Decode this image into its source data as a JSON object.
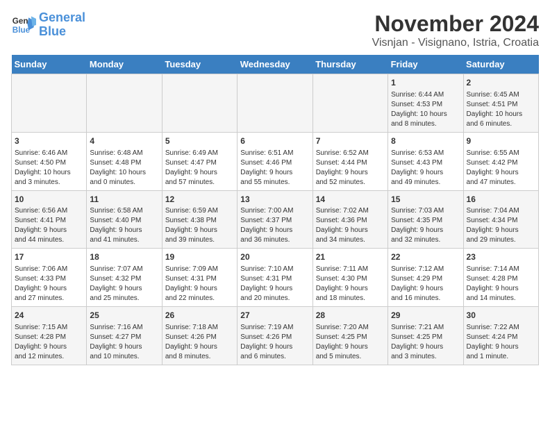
{
  "logo": {
    "line1": "General",
    "line2": "Blue"
  },
  "title": "November 2024",
  "subtitle": "Visnjan - Visignano, Istria, Croatia",
  "weekdays": [
    "Sunday",
    "Monday",
    "Tuesday",
    "Wednesday",
    "Thursday",
    "Friday",
    "Saturday"
  ],
  "weeks": [
    [
      {
        "day": "",
        "info": ""
      },
      {
        "day": "",
        "info": ""
      },
      {
        "day": "",
        "info": ""
      },
      {
        "day": "",
        "info": ""
      },
      {
        "day": "",
        "info": ""
      },
      {
        "day": "1",
        "info": "Sunrise: 6:44 AM\nSunset: 4:53 PM\nDaylight: 10 hours\nand 8 minutes."
      },
      {
        "day": "2",
        "info": "Sunrise: 6:45 AM\nSunset: 4:51 PM\nDaylight: 10 hours\nand 6 minutes."
      }
    ],
    [
      {
        "day": "3",
        "info": "Sunrise: 6:46 AM\nSunset: 4:50 PM\nDaylight: 10 hours\nand 3 minutes."
      },
      {
        "day": "4",
        "info": "Sunrise: 6:48 AM\nSunset: 4:48 PM\nDaylight: 10 hours\nand 0 minutes."
      },
      {
        "day": "5",
        "info": "Sunrise: 6:49 AM\nSunset: 4:47 PM\nDaylight: 9 hours\nand 57 minutes."
      },
      {
        "day": "6",
        "info": "Sunrise: 6:51 AM\nSunset: 4:46 PM\nDaylight: 9 hours\nand 55 minutes."
      },
      {
        "day": "7",
        "info": "Sunrise: 6:52 AM\nSunset: 4:44 PM\nDaylight: 9 hours\nand 52 minutes."
      },
      {
        "day": "8",
        "info": "Sunrise: 6:53 AM\nSunset: 4:43 PM\nDaylight: 9 hours\nand 49 minutes."
      },
      {
        "day": "9",
        "info": "Sunrise: 6:55 AM\nSunset: 4:42 PM\nDaylight: 9 hours\nand 47 minutes."
      }
    ],
    [
      {
        "day": "10",
        "info": "Sunrise: 6:56 AM\nSunset: 4:41 PM\nDaylight: 9 hours\nand 44 minutes."
      },
      {
        "day": "11",
        "info": "Sunrise: 6:58 AM\nSunset: 4:40 PM\nDaylight: 9 hours\nand 41 minutes."
      },
      {
        "day": "12",
        "info": "Sunrise: 6:59 AM\nSunset: 4:38 PM\nDaylight: 9 hours\nand 39 minutes."
      },
      {
        "day": "13",
        "info": "Sunrise: 7:00 AM\nSunset: 4:37 PM\nDaylight: 9 hours\nand 36 minutes."
      },
      {
        "day": "14",
        "info": "Sunrise: 7:02 AM\nSunset: 4:36 PM\nDaylight: 9 hours\nand 34 minutes."
      },
      {
        "day": "15",
        "info": "Sunrise: 7:03 AM\nSunset: 4:35 PM\nDaylight: 9 hours\nand 32 minutes."
      },
      {
        "day": "16",
        "info": "Sunrise: 7:04 AM\nSunset: 4:34 PM\nDaylight: 9 hours\nand 29 minutes."
      }
    ],
    [
      {
        "day": "17",
        "info": "Sunrise: 7:06 AM\nSunset: 4:33 PM\nDaylight: 9 hours\nand 27 minutes."
      },
      {
        "day": "18",
        "info": "Sunrise: 7:07 AM\nSunset: 4:32 PM\nDaylight: 9 hours\nand 25 minutes."
      },
      {
        "day": "19",
        "info": "Sunrise: 7:09 AM\nSunset: 4:31 PM\nDaylight: 9 hours\nand 22 minutes."
      },
      {
        "day": "20",
        "info": "Sunrise: 7:10 AM\nSunset: 4:31 PM\nDaylight: 9 hours\nand 20 minutes."
      },
      {
        "day": "21",
        "info": "Sunrise: 7:11 AM\nSunset: 4:30 PM\nDaylight: 9 hours\nand 18 minutes."
      },
      {
        "day": "22",
        "info": "Sunrise: 7:12 AM\nSunset: 4:29 PM\nDaylight: 9 hours\nand 16 minutes."
      },
      {
        "day": "23",
        "info": "Sunrise: 7:14 AM\nSunset: 4:28 PM\nDaylight: 9 hours\nand 14 minutes."
      }
    ],
    [
      {
        "day": "24",
        "info": "Sunrise: 7:15 AM\nSunset: 4:28 PM\nDaylight: 9 hours\nand 12 minutes."
      },
      {
        "day": "25",
        "info": "Sunrise: 7:16 AM\nSunset: 4:27 PM\nDaylight: 9 hours\nand 10 minutes."
      },
      {
        "day": "26",
        "info": "Sunrise: 7:18 AM\nSunset: 4:26 PM\nDaylight: 9 hours\nand 8 minutes."
      },
      {
        "day": "27",
        "info": "Sunrise: 7:19 AM\nSunset: 4:26 PM\nDaylight: 9 hours\nand 6 minutes."
      },
      {
        "day": "28",
        "info": "Sunrise: 7:20 AM\nSunset: 4:25 PM\nDaylight: 9 hours\nand 5 minutes."
      },
      {
        "day": "29",
        "info": "Sunrise: 7:21 AM\nSunset: 4:25 PM\nDaylight: 9 hours\nand 3 minutes."
      },
      {
        "day": "30",
        "info": "Sunrise: 7:22 AM\nSunset: 4:24 PM\nDaylight: 9 hours\nand 1 minute."
      }
    ]
  ]
}
